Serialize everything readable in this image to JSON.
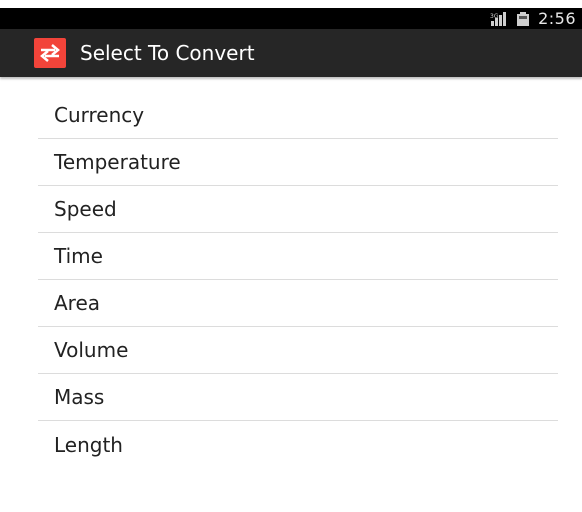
{
  "status_bar": {
    "time": "2:56",
    "icons": [
      "signal-icon",
      "battery-icon"
    ]
  },
  "action_bar": {
    "icon": "swap-arrows-icon",
    "title": "Select To Convert"
  },
  "list": {
    "items": [
      {
        "label": "Currency"
      },
      {
        "label": "Temperature"
      },
      {
        "label": "Speed"
      },
      {
        "label": "Time"
      },
      {
        "label": "Area"
      },
      {
        "label": "Volume"
      },
      {
        "label": "Mass"
      },
      {
        "label": "Length"
      }
    ]
  },
  "colors": {
    "status_bar_bg": "#000000",
    "action_bar_bg": "#262626",
    "app_icon_bg": "#f2443a",
    "divider": "#dcdcdc",
    "list_text": "#222222"
  }
}
